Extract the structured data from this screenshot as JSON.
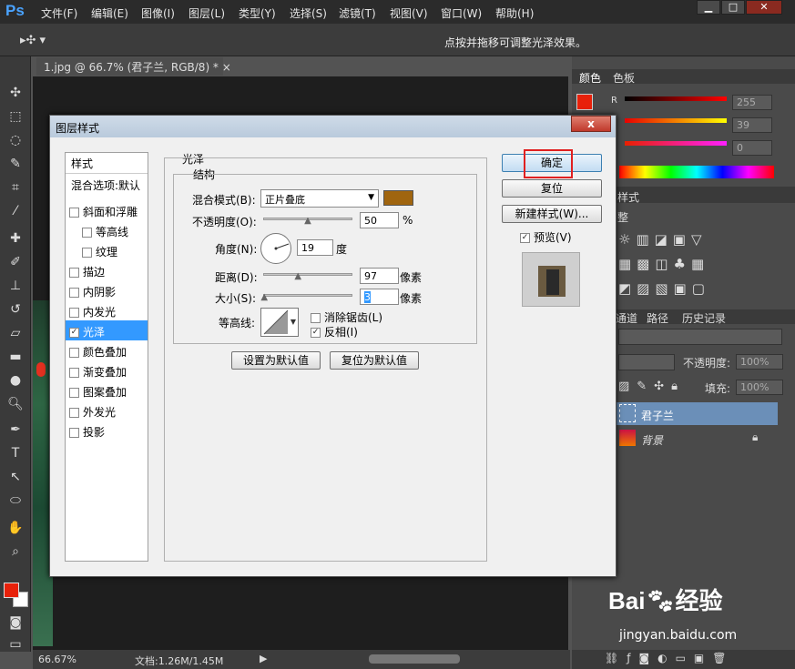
{
  "app": {
    "logo": "Ps"
  },
  "menu": [
    "文件(F)",
    "编辑(E)",
    "图像(I)",
    "图层(L)",
    "类型(Y)",
    "选择(S)",
    "滤镜(T)",
    "视图(V)",
    "窗口(W)",
    "帮助(H)"
  ],
  "window_controls": [
    "▁",
    "□",
    "✕"
  ],
  "options_bar": {
    "hint": "点按并拖移可调整光泽效果。"
  },
  "doc_tab": {
    "title": "1.jpg @ 66.7% (君子兰, RGB/8) *",
    "close": "×"
  },
  "status": {
    "zoom": "66.67%",
    "doc_info": "文档:1.26M/1.45M"
  },
  "right_panel": {
    "color_tabs": [
      "颜色",
      "色板"
    ],
    "color_sliders": [
      {
        "label": "R",
        "value": "255"
      },
      {
        "label": "",
        "value": "39"
      },
      {
        "label": "",
        "value": "0"
      }
    ],
    "styles_tab": "样式",
    "adjust_label": "整",
    "layer_tabs": [
      "通道",
      "路径",
      "历史记录"
    ],
    "opacity_label": "不透明度:",
    "opacity_value": "100%",
    "fill_label": "填充:",
    "fill_value": "100%",
    "layers": [
      {
        "name": "君子兰",
        "selected": true
      },
      {
        "name": "背景",
        "selected": false
      }
    ]
  },
  "dialog": {
    "title": "图层样式",
    "close": "x",
    "styles_header": "样式",
    "blend_options": "混合选项:默认",
    "styles": [
      {
        "label": "斜面和浮雕",
        "checked": false,
        "indent": false
      },
      {
        "label": "等高线",
        "checked": false,
        "indent": true
      },
      {
        "label": "纹理",
        "checked": false,
        "indent": true
      },
      {
        "label": "描边",
        "checked": false,
        "indent": false
      },
      {
        "label": "内阴影",
        "checked": false,
        "indent": false
      },
      {
        "label": "内发光",
        "checked": false,
        "indent": false
      },
      {
        "label": "光泽",
        "checked": true,
        "indent": false,
        "selected": true
      },
      {
        "label": "颜色叠加",
        "checked": false,
        "indent": false
      },
      {
        "label": "渐变叠加",
        "checked": false,
        "indent": false
      },
      {
        "label": "图案叠加",
        "checked": false,
        "indent": false
      },
      {
        "label": "外发光",
        "checked": false,
        "indent": false
      },
      {
        "label": "投影",
        "checked": false,
        "indent": false
      }
    ],
    "section_title": "光泽",
    "structure_title": "结构",
    "blend_mode_label": "混合模式(B):",
    "blend_mode_value": "正片叠底",
    "blend_color": "#a0650f",
    "opacity_label": "不透明度(O):",
    "opacity_value": "50",
    "opacity_unit": "%",
    "opacity_frac": 0.5,
    "angle_label": "角度(N):",
    "angle_value": "19",
    "angle_unit": "度",
    "distance_label": "距离(D):",
    "distance_value": "97",
    "distance_unit": "像素",
    "distance_frac": 0.39,
    "size_label": "大小(S):",
    "size_value": "3",
    "size_unit": "像素",
    "size_frac": 0.012,
    "contour_label": "等高线:",
    "antialias_label": "消除锯齿(L)",
    "antialias_checked": false,
    "invert_label": "反相(I)",
    "invert_checked": true,
    "set_default": "设置为默认值",
    "reset_default": "复位为默认值",
    "ok": "确定",
    "reset": "复位",
    "new_style": "新建样式(W)...",
    "preview_label": "预览(V)",
    "preview_checked": true
  },
  "watermark": {
    "brand": "Bai",
    "brand2": "经验",
    "url": "jingyan.baidu.com"
  },
  "colors": {
    "fg": "#e8210a",
    "bg": "#ffffff",
    "highlight": "#3399ff",
    "ok_border": "#e02020"
  }
}
